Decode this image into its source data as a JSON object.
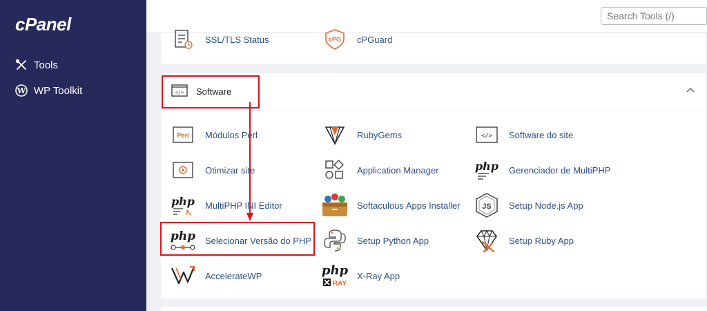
{
  "brand": {
    "logo_text": "cPanel"
  },
  "sidebar": {
    "items": [
      {
        "label": "Tools",
        "icon": "tools-icon"
      },
      {
        "label": "WP Toolkit",
        "icon": "wordpress-icon"
      }
    ]
  },
  "topbar": {
    "search_placeholder": "Search Tools (/)"
  },
  "security_row": [
    {
      "label": "SSL/TLS Status",
      "icon": "ssl-status-icon"
    },
    {
      "label": "cPGuard",
      "icon": "cpguard-icon"
    }
  ],
  "software": {
    "title": "Software",
    "tools": [
      {
        "label": "Módulos Perl",
        "icon": "perl-icon"
      },
      {
        "label": "RubyGems",
        "icon": "rubygems-icon"
      },
      {
        "label": "Software do site",
        "icon": "code-icon"
      },
      {
        "label": "Otimizar site",
        "icon": "optimize-icon"
      },
      {
        "label": "Application Manager",
        "icon": "app-manager-icon"
      },
      {
        "label": "Gerenciador de MultiPHP",
        "icon": "multiphp-manager-icon"
      },
      {
        "label": "MultiPHP INI Editor",
        "icon": "php-ini-icon"
      },
      {
        "label": "Softaculous Apps Installer",
        "icon": "softaculous-icon"
      },
      {
        "label": "Setup Node.js App",
        "icon": "nodejs-icon"
      },
      {
        "label": "Selecionar Versão do PHP",
        "icon": "php-version-icon"
      },
      {
        "label": "Setup Python App",
        "icon": "python-icon"
      },
      {
        "label": "Setup Ruby App",
        "icon": "ruby-icon"
      },
      {
        "label": "AccelerateWP",
        "icon": "acceleratewp-icon"
      },
      {
        "label": "X-Ray App",
        "icon": "xray-icon"
      }
    ]
  },
  "icon_text": {
    "perl": "Perl",
    "php": "php",
    "cpg": "cPG",
    "xray": "RAY",
    "code": "</>",
    "node": "JS"
  },
  "colors": {
    "sidebar": "#26295a",
    "link": "#2c4f85",
    "highlight": "#e0101b",
    "accent_orange": "#e8672c"
  }
}
